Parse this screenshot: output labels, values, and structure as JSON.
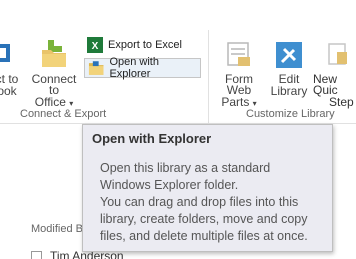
{
  "ribbon": {
    "connect_group": {
      "label": "Connect & Export",
      "partial_left_label_1": "ct to",
      "partial_left_label_2": "ook",
      "connect_office_1": "Connect to",
      "connect_office_2": "Office",
      "export_excel": "Export to Excel",
      "open_explorer": "Open with Explorer"
    },
    "customize_group": {
      "label": "Customize Library",
      "form_web_parts_1": "Form Web",
      "form_web_parts_2": "Parts",
      "edit_library_1": "Edit",
      "edit_library_2": "Library",
      "new_quick_step_1": "New Quic",
      "new_quick_step_2": "Step"
    }
  },
  "tooltip": {
    "title": "Open with Explorer",
    "line1": "Open this library as a standard",
    "line2": "Windows Explorer folder.",
    "line3": "You can drag and drop files into this",
    "line4": "library, create folders, move and copy",
    "line5": "files, and delete multiple files at once."
  },
  "list": {
    "modified_by_header": "Modified By",
    "first_row_name": "Tim Anderson"
  },
  "colors": {
    "tooltip_bg": "#ebebf2",
    "accent_blue": "#2a72b8",
    "excel_green": "#1f7a3a"
  }
}
